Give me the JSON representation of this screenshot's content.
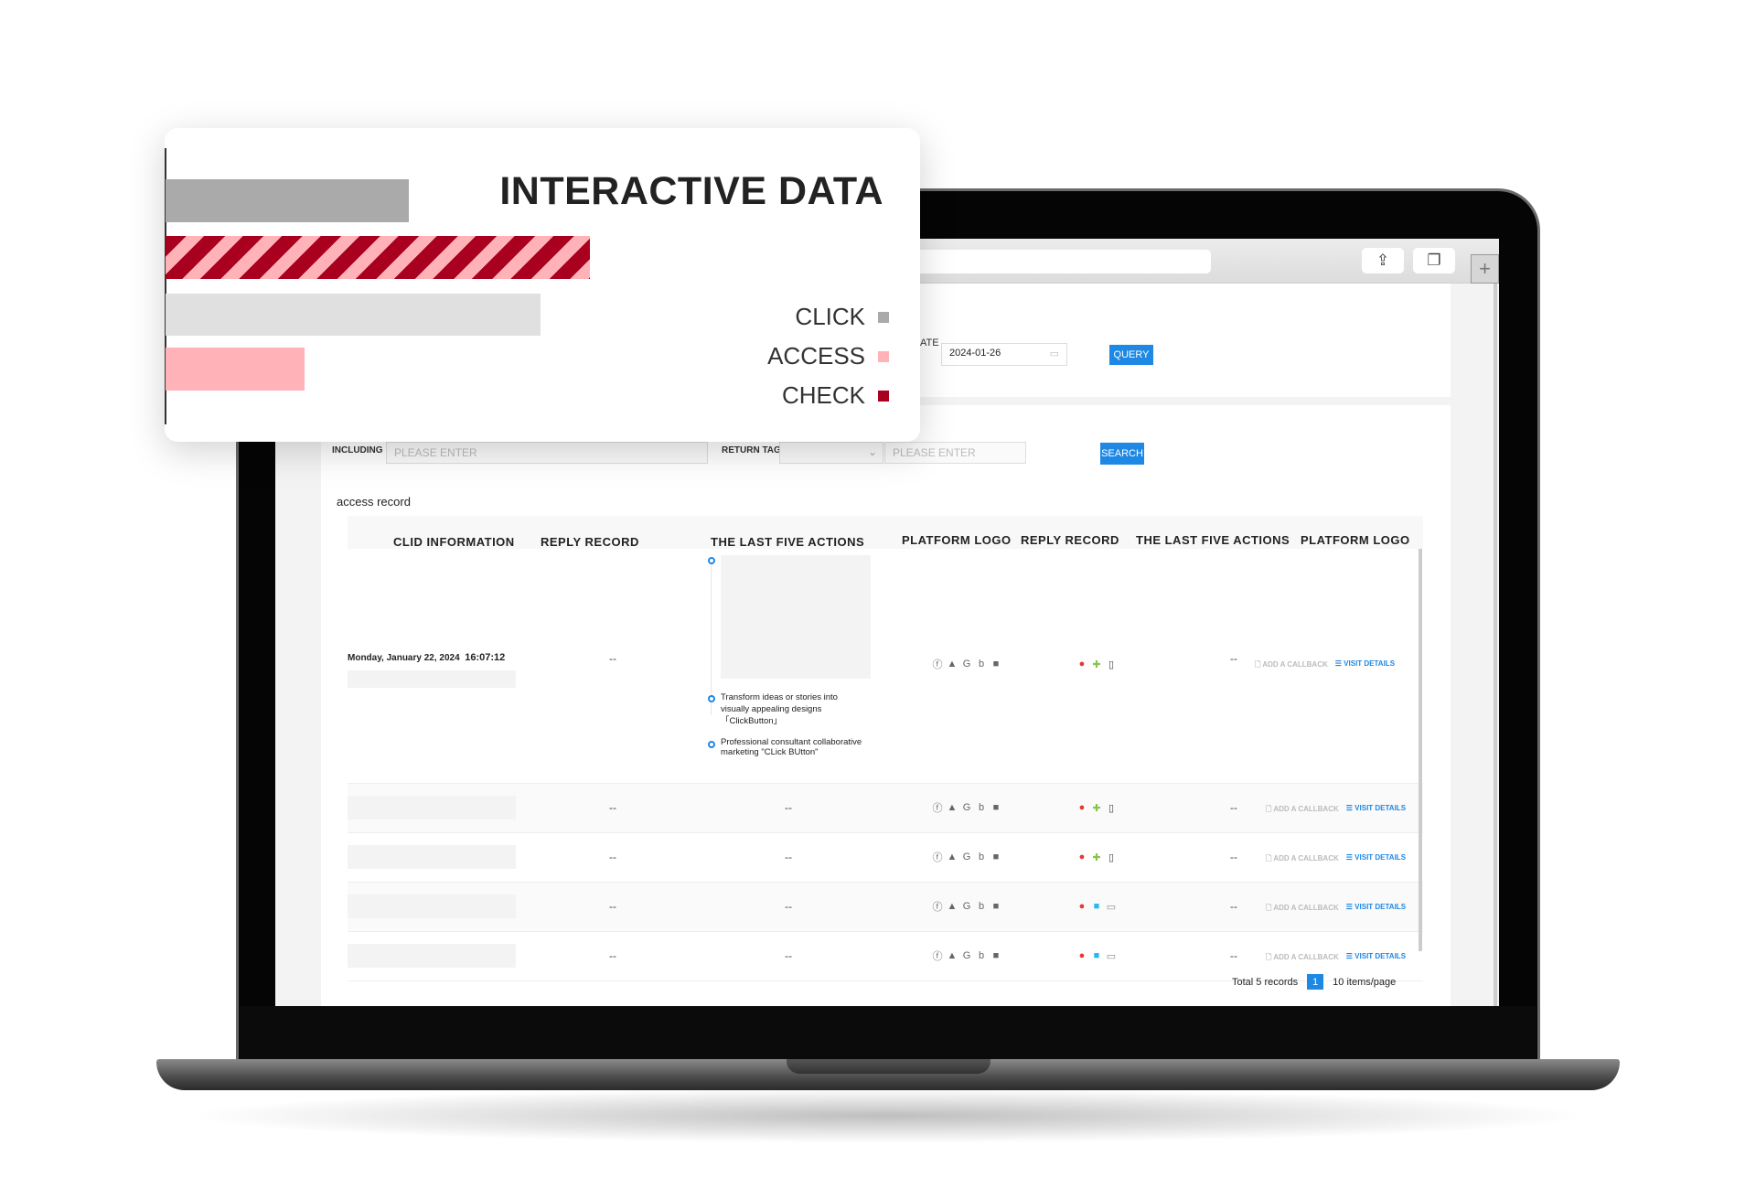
{
  "card": {
    "title": "INTERACTIVE DATA",
    "legend": [
      {
        "label": "CLICK",
        "color": "#aaaaaa"
      },
      {
        "label": "ACCESS",
        "color": "#ffb3b8"
      },
      {
        "label": "CHECK",
        "color": "#a8001e"
      }
    ],
    "bars": [
      {
        "series": "CLICK",
        "color": "#aaaaaa",
        "fraction": 0.35
      },
      {
        "series": "CHECK",
        "color": "striped",
        "fraction": 0.61
      },
      {
        "series": "CLICK-light",
        "color": "#e0e0e0",
        "fraction": 0.54
      },
      {
        "series": "ACCESS",
        "color": "#ffb3b8",
        "fraction": 0.2
      }
    ]
  },
  "browser": {
    "share_icon": "share-icon",
    "tabs_icon": "tabs-icon",
    "new_tab": "+"
  },
  "query_panel": {
    "date_label": "ATE",
    "date_value": "2024-01-26",
    "query_label": "QUERY"
  },
  "filters": {
    "including_label": "INCLUDING",
    "including_placeholder": "PLEASE ENTER",
    "return_tag_label": "RETURN TAG",
    "return_tag_value": "",
    "return_input_placeholder": "PLEASE ENTER",
    "search_label": "SEARCH"
  },
  "table": {
    "title": "access record",
    "headers": [
      "CLID INFORMATION",
      "REPLY RECORD",
      "THE LAST FIVE ACTIONS",
      "PLATFORM LOGO",
      "REPLY RECORD",
      "THE LAST FIVE ACTIONS",
      "PLATFORM LOGO"
    ],
    "add_callback": "ADD A CALLBACK",
    "visit_details": "VISIT DETAILS",
    "first_row": {
      "date": "Monday, January 22, 2024",
      "time": "16:07:12",
      "reply": "--",
      "actions": [
        "Transform ideas or stories into visually appealing designs 「ClickButton」",
        "Professional consultant collaborative marketing \"CLick BUtton\""
      ],
      "platforms": [
        "facebook-icon",
        "adwords-icon",
        "google-icon",
        "bing-icon",
        "tiktok-icon"
      ],
      "devices": [
        "chrome-icon",
        "android-icon",
        "mobile-icon"
      ],
      "reply2": "--"
    },
    "rows": [
      {
        "reply": "--",
        "actions": "--",
        "platforms": [
          "facebook-icon",
          "adwords-icon",
          "google-icon",
          "bing-icon",
          "tiktok-icon"
        ],
        "devices": [
          "chrome-icon",
          "android-icon",
          "mobile-icon"
        ],
        "reply2": "--"
      },
      {
        "reply": "--",
        "actions": "--",
        "platforms": [
          "facebook-icon",
          "adwords-icon",
          "google-icon",
          "bing-icon",
          "tiktok-icon"
        ],
        "devices": [
          "chrome-icon",
          "android-icon",
          "mobile-icon"
        ],
        "reply2": "--"
      },
      {
        "reply": "--",
        "actions": "--",
        "platforms": [
          "facebook-icon",
          "adwords-icon",
          "google-icon",
          "bing-icon",
          "tiktok-icon"
        ],
        "devices": [
          "chrome-icon",
          "finder-icon",
          "desktop-icon"
        ],
        "reply2": "--"
      },
      {
        "reply": "--",
        "actions": "--",
        "platforms": [
          "facebook-icon",
          "adwords-icon",
          "google-icon",
          "bing-icon",
          "tiktok-icon"
        ],
        "devices": [
          "chrome-icon",
          "finder-icon",
          "desktop-icon"
        ],
        "reply2": "--"
      }
    ],
    "pagination": {
      "total": "Total 5 records",
      "page": "1",
      "per_page": "10 items/page"
    }
  },
  "colors": {
    "accent": "#1e88e5",
    "check": "#a8001e",
    "access": "#ffb3b8",
    "click": "#aaaaaa"
  }
}
